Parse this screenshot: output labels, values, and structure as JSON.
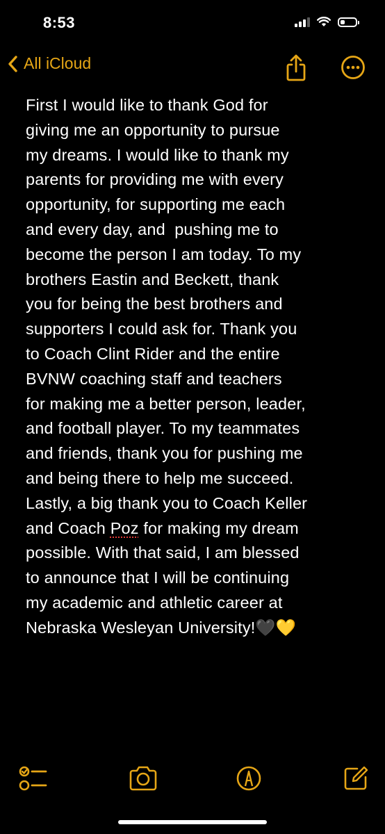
{
  "status_bar": {
    "time": "8:53",
    "battery_level": 0.3
  },
  "nav": {
    "back_label": "All iCloud"
  },
  "note": {
    "lines": [
      "First I would like to thank God for",
      "giving me an opportunity to pursue",
      "my dreams. I would like to thank my",
      "parents for providing me with every",
      "opportunity, for supporting me each",
      "and every day, and  pushing me to",
      "become the person I am today. To my",
      "brothers Eastin and Beckett, thank",
      "you for being the best brothers and",
      "supporters I could ask for. Thank you",
      "to Coach Clint Rider and the entire",
      "BVNW coaching staff and teachers",
      "for making me a better person, leader,",
      "and football player. To my teammates",
      "and friends, thank you for pushing me",
      "and being there to help me succeed.",
      "Lastly, a big thank you to Coach Keller",
      "and Coach ",
      "Poz",
      " for making my dream",
      "possible. With that said, I am blessed",
      "to announce that I will be continuing",
      "my academic and athletic career at",
      "Nebraska Wesleyan University!🖤💛"
    ]
  },
  "colors": {
    "accent": "#e6a616",
    "background": "#000000",
    "text": "#ffffff",
    "spellcheck": "#e53935"
  },
  "toolbar": {
    "icons": [
      "checklist-icon",
      "camera-icon",
      "markup-icon",
      "compose-icon"
    ]
  }
}
